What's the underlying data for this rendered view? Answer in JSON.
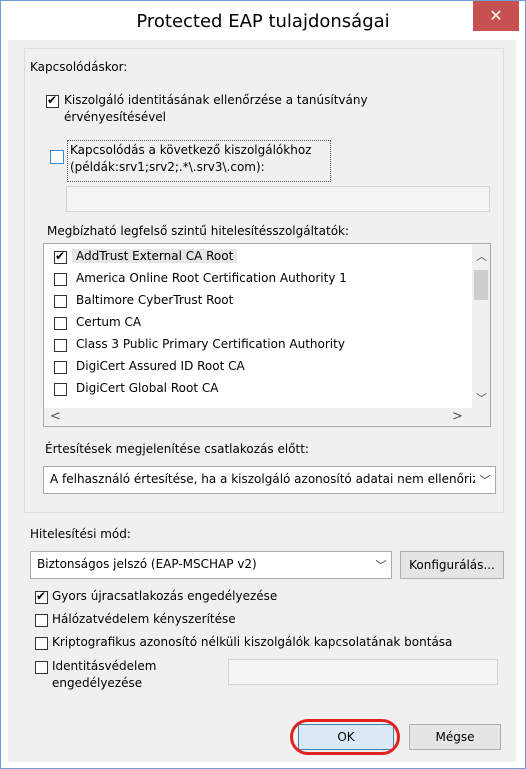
{
  "window": {
    "title": "Protected EAP tulajdonságai",
    "close_label": "✕"
  },
  "connecting": {
    "group_label": "Kapcsolódáskor:",
    "verify_server_line1": "Kiszolgáló identitásának ellenőrzése a tanúsítvány",
    "verify_server_line2": "érvényesítésével",
    "connect_servers_line1": "Kapcsolódás a következő kiszolgálókhoz",
    "connect_servers_line2": "(példák:srv1;srv2;.*\\.srv3\\.com):",
    "servers_value": ""
  },
  "trusted": {
    "label": "Megbízható legfelső szintű hitelesítésszolgáltatók:",
    "items": [
      {
        "label": "AddTrust External CA Root",
        "checked": true
      },
      {
        "label": "America Online Root Certification Authority 1",
        "checked": false
      },
      {
        "label": "Baltimore CyberTrust Root",
        "checked": false
      },
      {
        "label": "Certum CA",
        "checked": false
      },
      {
        "label": "Class 3 Public Primary Certification Authority",
        "checked": false
      },
      {
        "label": "DigiCert Assured ID Root CA",
        "checked": false
      },
      {
        "label": "DigiCert Global Root CA",
        "checked": false
      }
    ]
  },
  "notifications": {
    "label": "Értesítések megjelenítése csatlakozás előtt:",
    "value": "A felhasználó értesítése, ha a kiszolgáló azonosító adatai nem ellenőrizhetők"
  },
  "auth": {
    "label": "Hitelesítési mód:",
    "method_value": "Biztonságos jelszó (EAP-MSCHAP v2)",
    "configure_label": "Konfigurálás..."
  },
  "options": {
    "fast_reconnect": "Gyors újracsatlakozás engedélyezése",
    "nap": "Hálózatvédelem kényszerítése",
    "disconnect": "Kriptografikus azonosító nélküli kiszolgálók kapcsolatának bontása",
    "identity_line1": "Identitásvédelem",
    "identity_line2": "engedélyezése",
    "identity_value": ""
  },
  "buttons": {
    "ok": "OK",
    "cancel": "Mégse"
  }
}
